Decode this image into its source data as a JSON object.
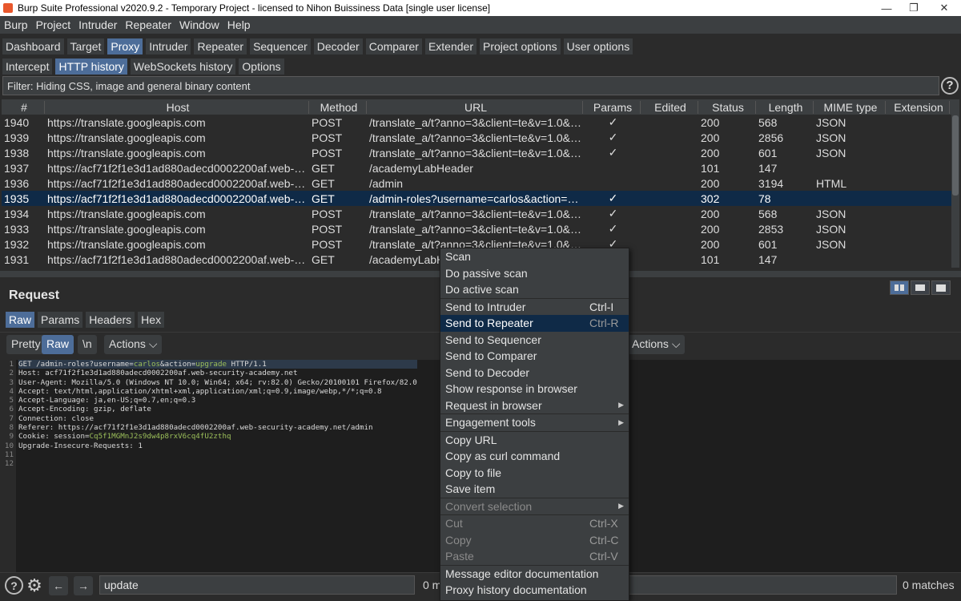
{
  "window": {
    "title": "Burp Suite Professional v2020.9.2 - Temporary Project - licensed to Nihon Buissiness Data [single user license]"
  },
  "menu": [
    "Burp",
    "Project",
    "Intruder",
    "Repeater",
    "Window",
    "Help"
  ],
  "main_tabs": [
    "Dashboard",
    "Target",
    "Proxy",
    "Intruder",
    "Repeater",
    "Sequencer",
    "Decoder",
    "Comparer",
    "Extender",
    "Project options",
    "User options"
  ],
  "proxy_tabs": [
    "Intercept",
    "HTTP history",
    "WebSockets history",
    "Options"
  ],
  "filter": {
    "text": "Filter: Hiding CSS, image and general binary content"
  },
  "table": {
    "headers": [
      "#",
      "Host",
      "Method",
      "URL",
      "Params",
      "Edited",
      "Status",
      "Length",
      "MIME type",
      "Extension"
    ],
    "rows": [
      [
        "1940",
        "https://translate.googleapis.com",
        "POST",
        "/translate_a/t?anno=3&client=te&v=1.0&form...",
        "✓",
        "",
        "200",
        "568",
        "JSON",
        ""
      ],
      [
        "1939",
        "https://translate.googleapis.com",
        "POST",
        "/translate_a/t?anno=3&client=te&v=1.0&form...",
        "✓",
        "",
        "200",
        "2856",
        "JSON",
        ""
      ],
      [
        "1938",
        "https://translate.googleapis.com",
        "POST",
        "/translate_a/t?anno=3&client=te&v=1.0&form...",
        "✓",
        "",
        "200",
        "601",
        "JSON",
        ""
      ],
      [
        "1937",
        "https://acf71f2f1e3d1ad880adecd0002200af.web-secur...",
        "GET",
        "/academyLabHeader",
        "",
        "",
        "101",
        "147",
        "",
        ""
      ],
      [
        "1936",
        "https://acf71f2f1e3d1ad880adecd0002200af.web-secur...",
        "GET",
        "/admin",
        "",
        "",
        "200",
        "3194",
        "HTML",
        ""
      ],
      [
        "1935",
        "https://acf71f2f1e3d1ad880adecd0002200af.web-secur...",
        "GET",
        "/admin-roles?username=carlos&action=upgr...",
        "✓",
        "",
        "302",
        "78",
        "",
        ""
      ],
      [
        "1934",
        "https://translate.googleapis.com",
        "POST",
        "/translate_a/t?anno=3&client=te&v=1.0&form...",
        "✓",
        "",
        "200",
        "568",
        "JSON",
        ""
      ],
      [
        "1933",
        "https://translate.googleapis.com",
        "POST",
        "/translate_a/t?anno=3&client=te&v=1.0&form...",
        "✓",
        "",
        "200",
        "2853",
        "JSON",
        ""
      ],
      [
        "1932",
        "https://translate.googleapis.com",
        "POST",
        "/translate_a/t?anno=3&client=te&v=1.0&form...",
        "✓",
        "",
        "200",
        "601",
        "JSON",
        ""
      ],
      [
        "1931",
        "https://acf71f2f1e3d1ad880adecd0002200af.web-secur...",
        "GET",
        "/academyLabHe",
        "",
        "",
        "101",
        "147",
        "",
        ""
      ]
    ],
    "selected_row": "1935"
  },
  "request": {
    "title": "Request",
    "tabs": [
      "Raw",
      "Params",
      "Headers",
      "Hex"
    ],
    "editor_buttons": {
      "pretty": "Pretty",
      "raw": "Raw",
      "newline": "\\n",
      "actions": "Actions"
    },
    "lines": [
      "GET /admin-roles?username=carlos&action=upgrade HTTP/1.1",
      "Host: acf71f2f1e3d1ad880adecd0002200af.web-security-academy.net",
      "User-Agent: Mozilla/5.0 (Windows NT 10.0; Win64; x64; rv:82.0) Gecko/20100101 Firefox/82.0",
      "Accept: text/html,application/xhtml+xml,application/xml;q=0.9,image/webp,*/*;q=0.8",
      "Accept-Language: ja,en-US;q=0.7,en;q=0.3",
      "Accept-Encoding: gzip, deflate",
      "Connection: close",
      "Referer: https://acf71f2f1e3d1ad880adecd0002200af.web-security-academy.net/admin",
      "Cookie: session=Cq5f1MGMnJ2s9dw4p8rxV6cq4fU2zthq",
      "Upgrade-Insecure-Requests: 1",
      "",
      ""
    ]
  },
  "response_actions": "Actions",
  "bottom": {
    "search_value": "update",
    "matches_left": "0 m",
    "matches_right": "0 matches"
  },
  "context_menu": {
    "items": [
      {
        "label": "Scan",
        "shortcut": "",
        "submenu": false,
        "disabled": false
      },
      {
        "label": "Do passive scan",
        "shortcut": "",
        "submenu": false,
        "disabled": false
      },
      {
        "label": "Do active scan",
        "shortcut": "",
        "submenu": false,
        "disabled": false,
        "sep_after": true
      },
      {
        "label": "Send to Intruder",
        "shortcut": "Ctrl-I",
        "submenu": false,
        "disabled": false
      },
      {
        "label": "Send to Repeater",
        "shortcut": "Ctrl-R",
        "submenu": false,
        "disabled": false,
        "selected": true
      },
      {
        "label": "Send to Sequencer",
        "shortcut": "",
        "submenu": false,
        "disabled": false
      },
      {
        "label": "Send to Comparer",
        "shortcut": "",
        "submenu": false,
        "disabled": false
      },
      {
        "label": "Send to Decoder",
        "shortcut": "",
        "submenu": false,
        "disabled": false
      },
      {
        "label": "Show response in browser",
        "shortcut": "",
        "submenu": false,
        "disabled": false
      },
      {
        "label": "Request in browser",
        "shortcut": "",
        "submenu": true,
        "disabled": false,
        "sep_after": true
      },
      {
        "label": "Engagement tools",
        "shortcut": "",
        "submenu": true,
        "disabled": false,
        "sep_after": true
      },
      {
        "label": "Copy URL",
        "shortcut": "",
        "submenu": false,
        "disabled": false
      },
      {
        "label": "Copy as curl command",
        "shortcut": "",
        "submenu": false,
        "disabled": false
      },
      {
        "label": "Copy to file",
        "shortcut": "",
        "submenu": false,
        "disabled": false
      },
      {
        "label": "Save item",
        "shortcut": "",
        "submenu": false,
        "disabled": false,
        "sep_after": true
      },
      {
        "label": "Convert selection",
        "shortcut": "",
        "submenu": true,
        "disabled": true,
        "sep_after": true
      },
      {
        "label": "Cut",
        "shortcut": "Ctrl-X",
        "submenu": false,
        "disabled": true
      },
      {
        "label": "Copy",
        "shortcut": "Ctrl-C",
        "submenu": false,
        "disabled": true
      },
      {
        "label": "Paste",
        "shortcut": "Ctrl-V",
        "submenu": false,
        "disabled": true,
        "sep_after": true
      },
      {
        "label": "Message editor documentation",
        "shortcut": "",
        "submenu": false,
        "disabled": false
      },
      {
        "label": "Proxy history documentation",
        "shortcut": "",
        "submenu": false,
        "disabled": false
      }
    ]
  },
  "colors": {
    "accent": "#4d6d99",
    "selection": "#0f2a47",
    "background": "#2b2b2b"
  }
}
